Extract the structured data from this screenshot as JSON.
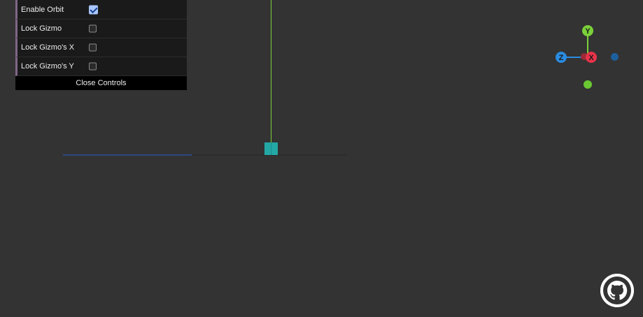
{
  "controls": {
    "items": [
      {
        "label": "Enable Orbit",
        "checked": true
      },
      {
        "label": "Lock Gizmo",
        "checked": false
      },
      {
        "label": "Lock Gizmo's X",
        "checked": false
      },
      {
        "label": "Lock Gizmo's Y",
        "checked": false
      }
    ],
    "close_label": "Close Controls"
  },
  "gizmo": {
    "y_label": "Y",
    "x_label": "X",
    "z_label": "Z"
  },
  "colors": {
    "background": "#333333",
    "axis_x": "#e8344b",
    "axis_y": "#7bd13a",
    "axis_z": "#2a8ce0",
    "cube": "#23a8a6"
  },
  "icons": {
    "github": "github-icon"
  }
}
